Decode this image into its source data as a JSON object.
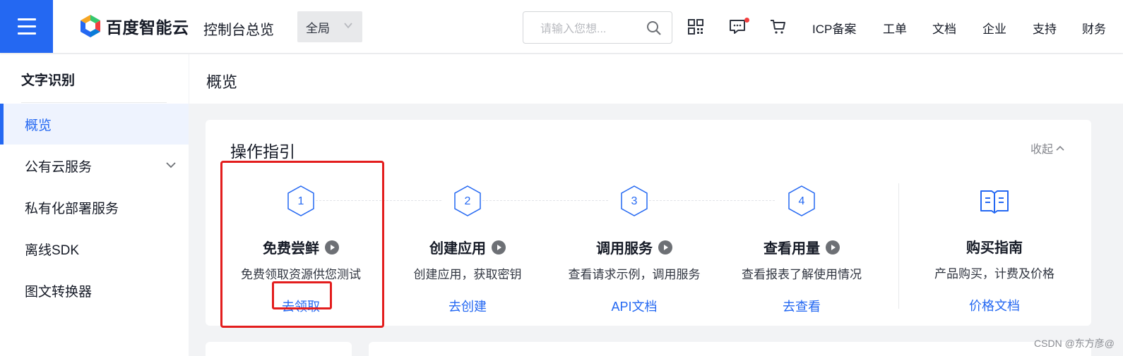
{
  "header": {
    "brand": "百度智能云",
    "console_title": "控制台总览",
    "scope": "全局",
    "search_placeholder": "请输入您想...",
    "nav": [
      "ICP备案",
      "工单",
      "文档",
      "企业",
      "支持",
      "财务"
    ],
    "icons": [
      "qrcode-icon",
      "message-icon",
      "cart-icon"
    ],
    "notification_dot_color": "#f33e3e"
  },
  "sidebar": {
    "title": "文字识别",
    "items": [
      {
        "label": "概览",
        "active": true
      },
      {
        "label": "公有云服务",
        "expandable": true
      },
      {
        "label": "私有化部署服务"
      },
      {
        "label": "离线SDK"
      },
      {
        "label": "图文转换器"
      }
    ]
  },
  "main": {
    "title": "概览",
    "guide": {
      "title": "操作指引",
      "collapse_label": "收起",
      "steps": [
        {
          "number": "1",
          "title": "免费尝鲜",
          "desc": "免费领取资源供您测试",
          "link": "去领取"
        },
        {
          "number": "2",
          "title": "创建应用",
          "desc": "创建应用，获取密钥",
          "link": "去创建"
        },
        {
          "number": "3",
          "title": "调用服务",
          "desc": "查看请求示例，调用服务",
          "link": "API文档"
        },
        {
          "number": "4",
          "title": "查看用量",
          "desc": "查看报表了解使用情况",
          "link": "去查看"
        }
      ],
      "purchase": {
        "title": "购买指南",
        "desc": "产品购买，计费及价格",
        "link": "价格文档"
      }
    }
  },
  "watermark": "CSDN @东方彦@",
  "colors": {
    "accent": "#2468f2",
    "highlight": "#e31d1d"
  }
}
